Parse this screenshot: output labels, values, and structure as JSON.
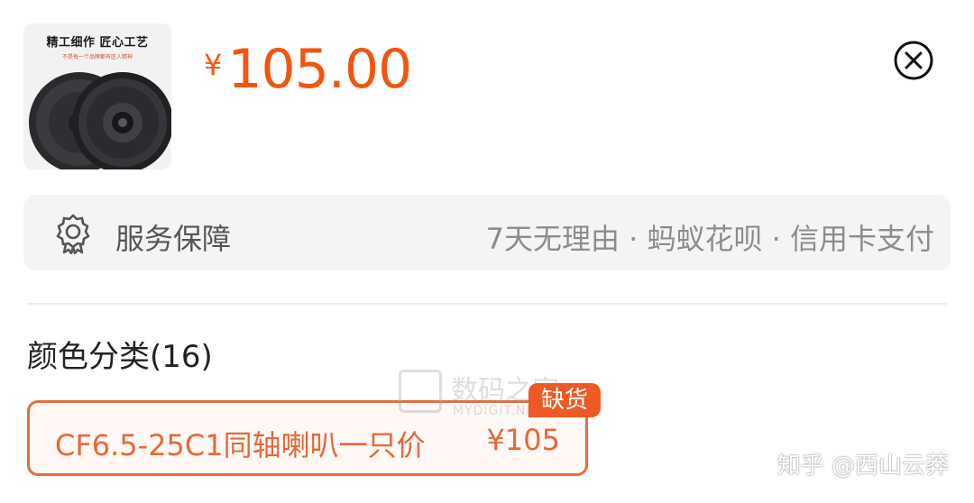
{
  "product": {
    "thumbnail": {
      "title": "精工细作 匠心工艺",
      "slogan": "不是每一个品牌都有匠人精神"
    },
    "currency_symbol": "¥",
    "price": "105.00"
  },
  "close_icon": "close-circle-icon",
  "service": {
    "icon": "badge-icon",
    "label": "服务保障",
    "detail": "7天无理由 · 蚂蚁花呗 · 信用卡支付"
  },
  "variants": {
    "title": "颜色分类(16)",
    "options": [
      {
        "name": "CF6.5-25C1同轴喇叭一只价",
        "price": "¥105",
        "tag": "缺货",
        "selected": true
      }
    ]
  },
  "watermarks": {
    "center_cn": "数码之家",
    "center_en": "MYDIGIT.NET",
    "corner": "知乎 @西山云莽"
  },
  "colors": {
    "accent": "#f2560e",
    "tag_bg": "#ee5a24",
    "panel_bg": "#f4f4f4"
  }
}
